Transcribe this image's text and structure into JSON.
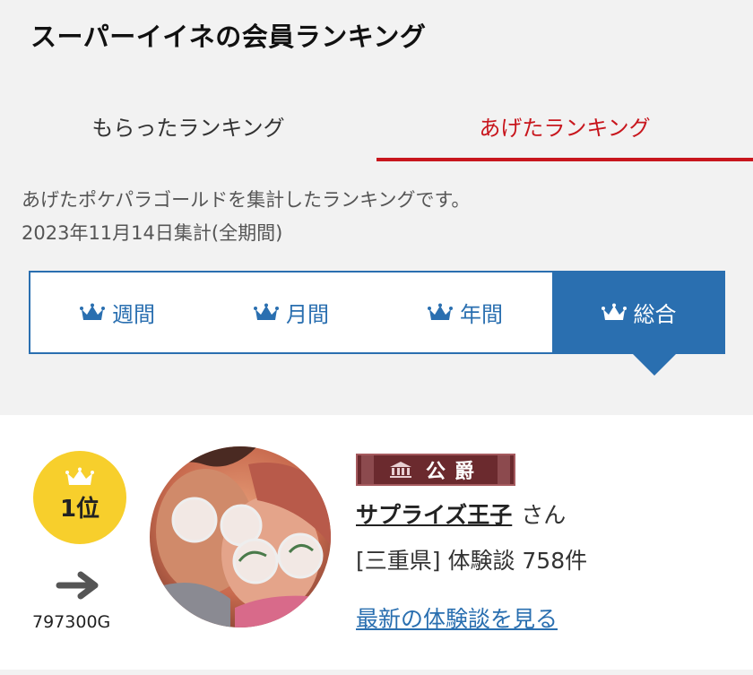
{
  "page_title": "スーパーイイネの会員ランキング",
  "main_tabs": [
    {
      "label": "もらったランキング"
    },
    {
      "label": "あげたランキング"
    }
  ],
  "description": {
    "line1": "あげたポケパラゴールドを集計したランキングです。",
    "line2": "2023年11月14日集計(全期間)"
  },
  "period_tabs": [
    {
      "label": "週間"
    },
    {
      "label": "月間"
    },
    {
      "label": "年間"
    },
    {
      "label": "総合"
    }
  ],
  "ranking": {
    "rank_label": "1位",
    "gold_amount": "797300G",
    "title_badge": "公爵",
    "username": "サプライズ王子",
    "honorific": "さん",
    "info": "[三重県] 体験談 758件",
    "latest_link": "最新の体験談を見る"
  },
  "colors": {
    "accent_red": "#c8161d",
    "accent_blue": "#2a6fb0",
    "rank_gold": "#f7cf2c",
    "badge_maroon": "#6b2a2e"
  },
  "icons": {
    "crown": "crown-icon",
    "trend": "arrow-right-icon"
  }
}
